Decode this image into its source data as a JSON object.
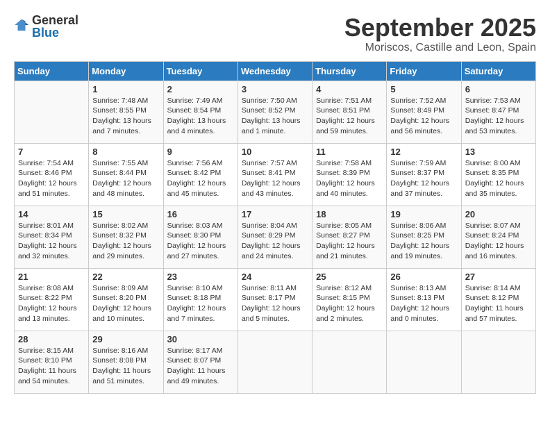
{
  "header": {
    "logo_general": "General",
    "logo_blue": "Blue",
    "title": "September 2025",
    "subtitle": "Moriscos, Castille and Leon, Spain"
  },
  "calendar": {
    "weekdays": [
      "Sunday",
      "Monday",
      "Tuesday",
      "Wednesday",
      "Thursday",
      "Friday",
      "Saturday"
    ],
    "weeks": [
      [
        {
          "day": "",
          "info": ""
        },
        {
          "day": "1",
          "info": "Sunrise: 7:48 AM\nSunset: 8:55 PM\nDaylight: 13 hours\nand 7 minutes."
        },
        {
          "day": "2",
          "info": "Sunrise: 7:49 AM\nSunset: 8:54 PM\nDaylight: 13 hours\nand 4 minutes."
        },
        {
          "day": "3",
          "info": "Sunrise: 7:50 AM\nSunset: 8:52 PM\nDaylight: 13 hours\nand 1 minute."
        },
        {
          "day": "4",
          "info": "Sunrise: 7:51 AM\nSunset: 8:51 PM\nDaylight: 12 hours\nand 59 minutes."
        },
        {
          "day": "5",
          "info": "Sunrise: 7:52 AM\nSunset: 8:49 PM\nDaylight: 12 hours\nand 56 minutes."
        },
        {
          "day": "6",
          "info": "Sunrise: 7:53 AM\nSunset: 8:47 PM\nDaylight: 12 hours\nand 53 minutes."
        }
      ],
      [
        {
          "day": "7",
          "info": "Sunrise: 7:54 AM\nSunset: 8:46 PM\nDaylight: 12 hours\nand 51 minutes."
        },
        {
          "day": "8",
          "info": "Sunrise: 7:55 AM\nSunset: 8:44 PM\nDaylight: 12 hours\nand 48 minutes."
        },
        {
          "day": "9",
          "info": "Sunrise: 7:56 AM\nSunset: 8:42 PM\nDaylight: 12 hours\nand 45 minutes."
        },
        {
          "day": "10",
          "info": "Sunrise: 7:57 AM\nSunset: 8:41 PM\nDaylight: 12 hours\nand 43 minutes."
        },
        {
          "day": "11",
          "info": "Sunrise: 7:58 AM\nSunset: 8:39 PM\nDaylight: 12 hours\nand 40 minutes."
        },
        {
          "day": "12",
          "info": "Sunrise: 7:59 AM\nSunset: 8:37 PM\nDaylight: 12 hours\nand 37 minutes."
        },
        {
          "day": "13",
          "info": "Sunrise: 8:00 AM\nSunset: 8:35 PM\nDaylight: 12 hours\nand 35 minutes."
        }
      ],
      [
        {
          "day": "14",
          "info": "Sunrise: 8:01 AM\nSunset: 8:34 PM\nDaylight: 12 hours\nand 32 minutes."
        },
        {
          "day": "15",
          "info": "Sunrise: 8:02 AM\nSunset: 8:32 PM\nDaylight: 12 hours\nand 29 minutes."
        },
        {
          "day": "16",
          "info": "Sunrise: 8:03 AM\nSunset: 8:30 PM\nDaylight: 12 hours\nand 27 minutes."
        },
        {
          "day": "17",
          "info": "Sunrise: 8:04 AM\nSunset: 8:29 PM\nDaylight: 12 hours\nand 24 minutes."
        },
        {
          "day": "18",
          "info": "Sunrise: 8:05 AM\nSunset: 8:27 PM\nDaylight: 12 hours\nand 21 minutes."
        },
        {
          "day": "19",
          "info": "Sunrise: 8:06 AM\nSunset: 8:25 PM\nDaylight: 12 hours\nand 19 minutes."
        },
        {
          "day": "20",
          "info": "Sunrise: 8:07 AM\nSunset: 8:24 PM\nDaylight: 12 hours\nand 16 minutes."
        }
      ],
      [
        {
          "day": "21",
          "info": "Sunrise: 8:08 AM\nSunset: 8:22 PM\nDaylight: 12 hours\nand 13 minutes."
        },
        {
          "day": "22",
          "info": "Sunrise: 8:09 AM\nSunset: 8:20 PM\nDaylight: 12 hours\nand 10 minutes."
        },
        {
          "day": "23",
          "info": "Sunrise: 8:10 AM\nSunset: 8:18 PM\nDaylight: 12 hours\nand 7 minutes."
        },
        {
          "day": "24",
          "info": "Sunrise: 8:11 AM\nSunset: 8:17 PM\nDaylight: 12 hours\nand 5 minutes."
        },
        {
          "day": "25",
          "info": "Sunrise: 8:12 AM\nSunset: 8:15 PM\nDaylight: 12 hours\nand 2 minutes."
        },
        {
          "day": "26",
          "info": "Sunrise: 8:13 AM\nSunset: 8:13 PM\nDaylight: 12 hours\nand 0 minutes."
        },
        {
          "day": "27",
          "info": "Sunrise: 8:14 AM\nSunset: 8:12 PM\nDaylight: 11 hours\nand 57 minutes."
        }
      ],
      [
        {
          "day": "28",
          "info": "Sunrise: 8:15 AM\nSunset: 8:10 PM\nDaylight: 11 hours\nand 54 minutes."
        },
        {
          "day": "29",
          "info": "Sunrise: 8:16 AM\nSunset: 8:08 PM\nDaylight: 11 hours\nand 51 minutes."
        },
        {
          "day": "30",
          "info": "Sunrise: 8:17 AM\nSunset: 8:07 PM\nDaylight: 11 hours\nand 49 minutes."
        },
        {
          "day": "",
          "info": ""
        },
        {
          "day": "",
          "info": ""
        },
        {
          "day": "",
          "info": ""
        },
        {
          "day": "",
          "info": ""
        }
      ]
    ]
  }
}
